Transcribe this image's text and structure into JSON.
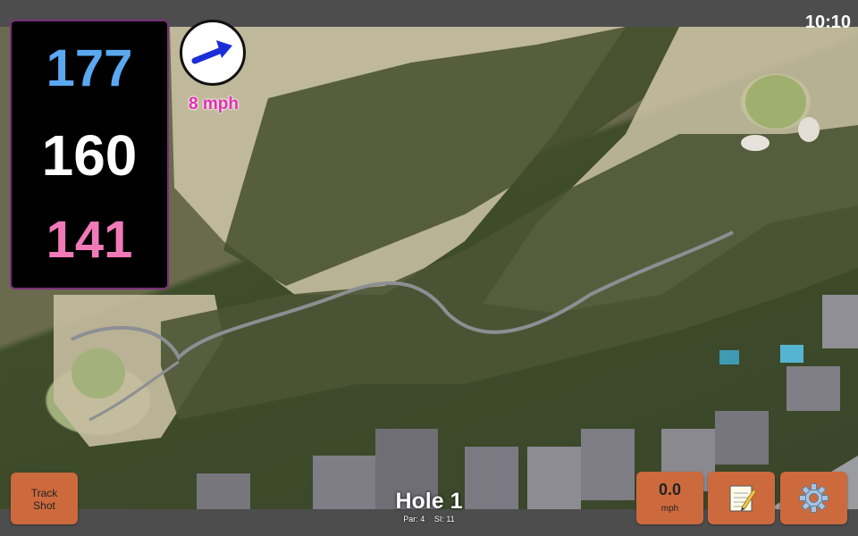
{
  "status": {
    "time": "10:10"
  },
  "yardage": {
    "back": "177",
    "middle": "160",
    "front": "141"
  },
  "wind": {
    "speed": "8 mph",
    "icon": "wind-direction-arrow-icon"
  },
  "buttons": {
    "track_shot_line1": "Track",
    "track_shot_line2": "Shot",
    "speed_value": "0.0",
    "speed_unit": "mph",
    "notes_icon": "notepad-icon",
    "settings_icon": "gear-icon"
  },
  "hole": {
    "title": "Hole 1",
    "par": "Par: 4",
    "si": "SI: 11"
  },
  "colors": {
    "back_yardage": "#5aa8f0",
    "middle_yardage": "#ffffff",
    "front_yardage": "#f07ab8",
    "wind_text": "#e22fb2",
    "button": "#cd6a3d",
    "arrow": "#1a2ed8"
  }
}
